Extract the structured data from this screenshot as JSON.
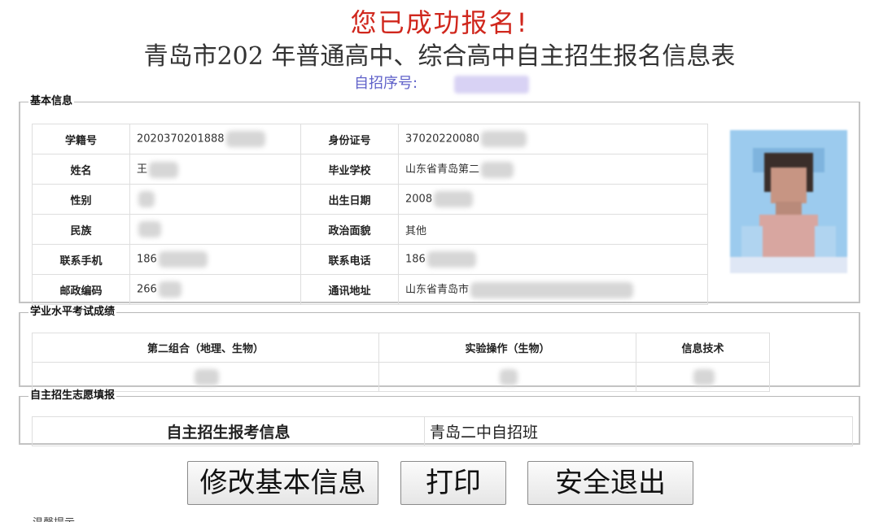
{
  "header": {
    "success": "您已成功报名!",
    "title": "青岛市202 年普通高中、综合高中自主招生报名信息表",
    "serial_label": "自招序号:"
  },
  "basic": {
    "legend": "基本信息",
    "rows": [
      {
        "l1": "学籍号",
        "v1": "2020370201888",
        "l2": "身份证号",
        "v2": "37020220080"
      },
      {
        "l1": "姓名",
        "v1": "王",
        "l2": "毕业学校",
        "v2": "山东省青岛第二"
      },
      {
        "l1": "性别",
        "v1": "",
        "l2": "出生日期",
        "v2": "2008"
      },
      {
        "l1": "民族",
        "v1": "",
        "l2": "政治面貌",
        "v2": "其他"
      },
      {
        "l1": "联系手机",
        "v1": "186",
        "l2": "联系电话",
        "v2": "186"
      },
      {
        "l1": "邮政编码",
        "v1": "266",
        "l2": "通讯地址",
        "v2": "山东省青岛市"
      }
    ]
  },
  "scores": {
    "legend": "学业水平考试成绩",
    "headers": [
      "第二组合（地理、生物）",
      "实验操作（生物）",
      "信息技术"
    ]
  },
  "wish": {
    "legend": "自主招生志愿填报",
    "label": "自主招生报考信息",
    "value": "青岛二中自招班"
  },
  "buttons": {
    "edit": "修改基本信息",
    "print": "打印",
    "logout": "安全退出"
  },
  "footer": "温馨提示"
}
